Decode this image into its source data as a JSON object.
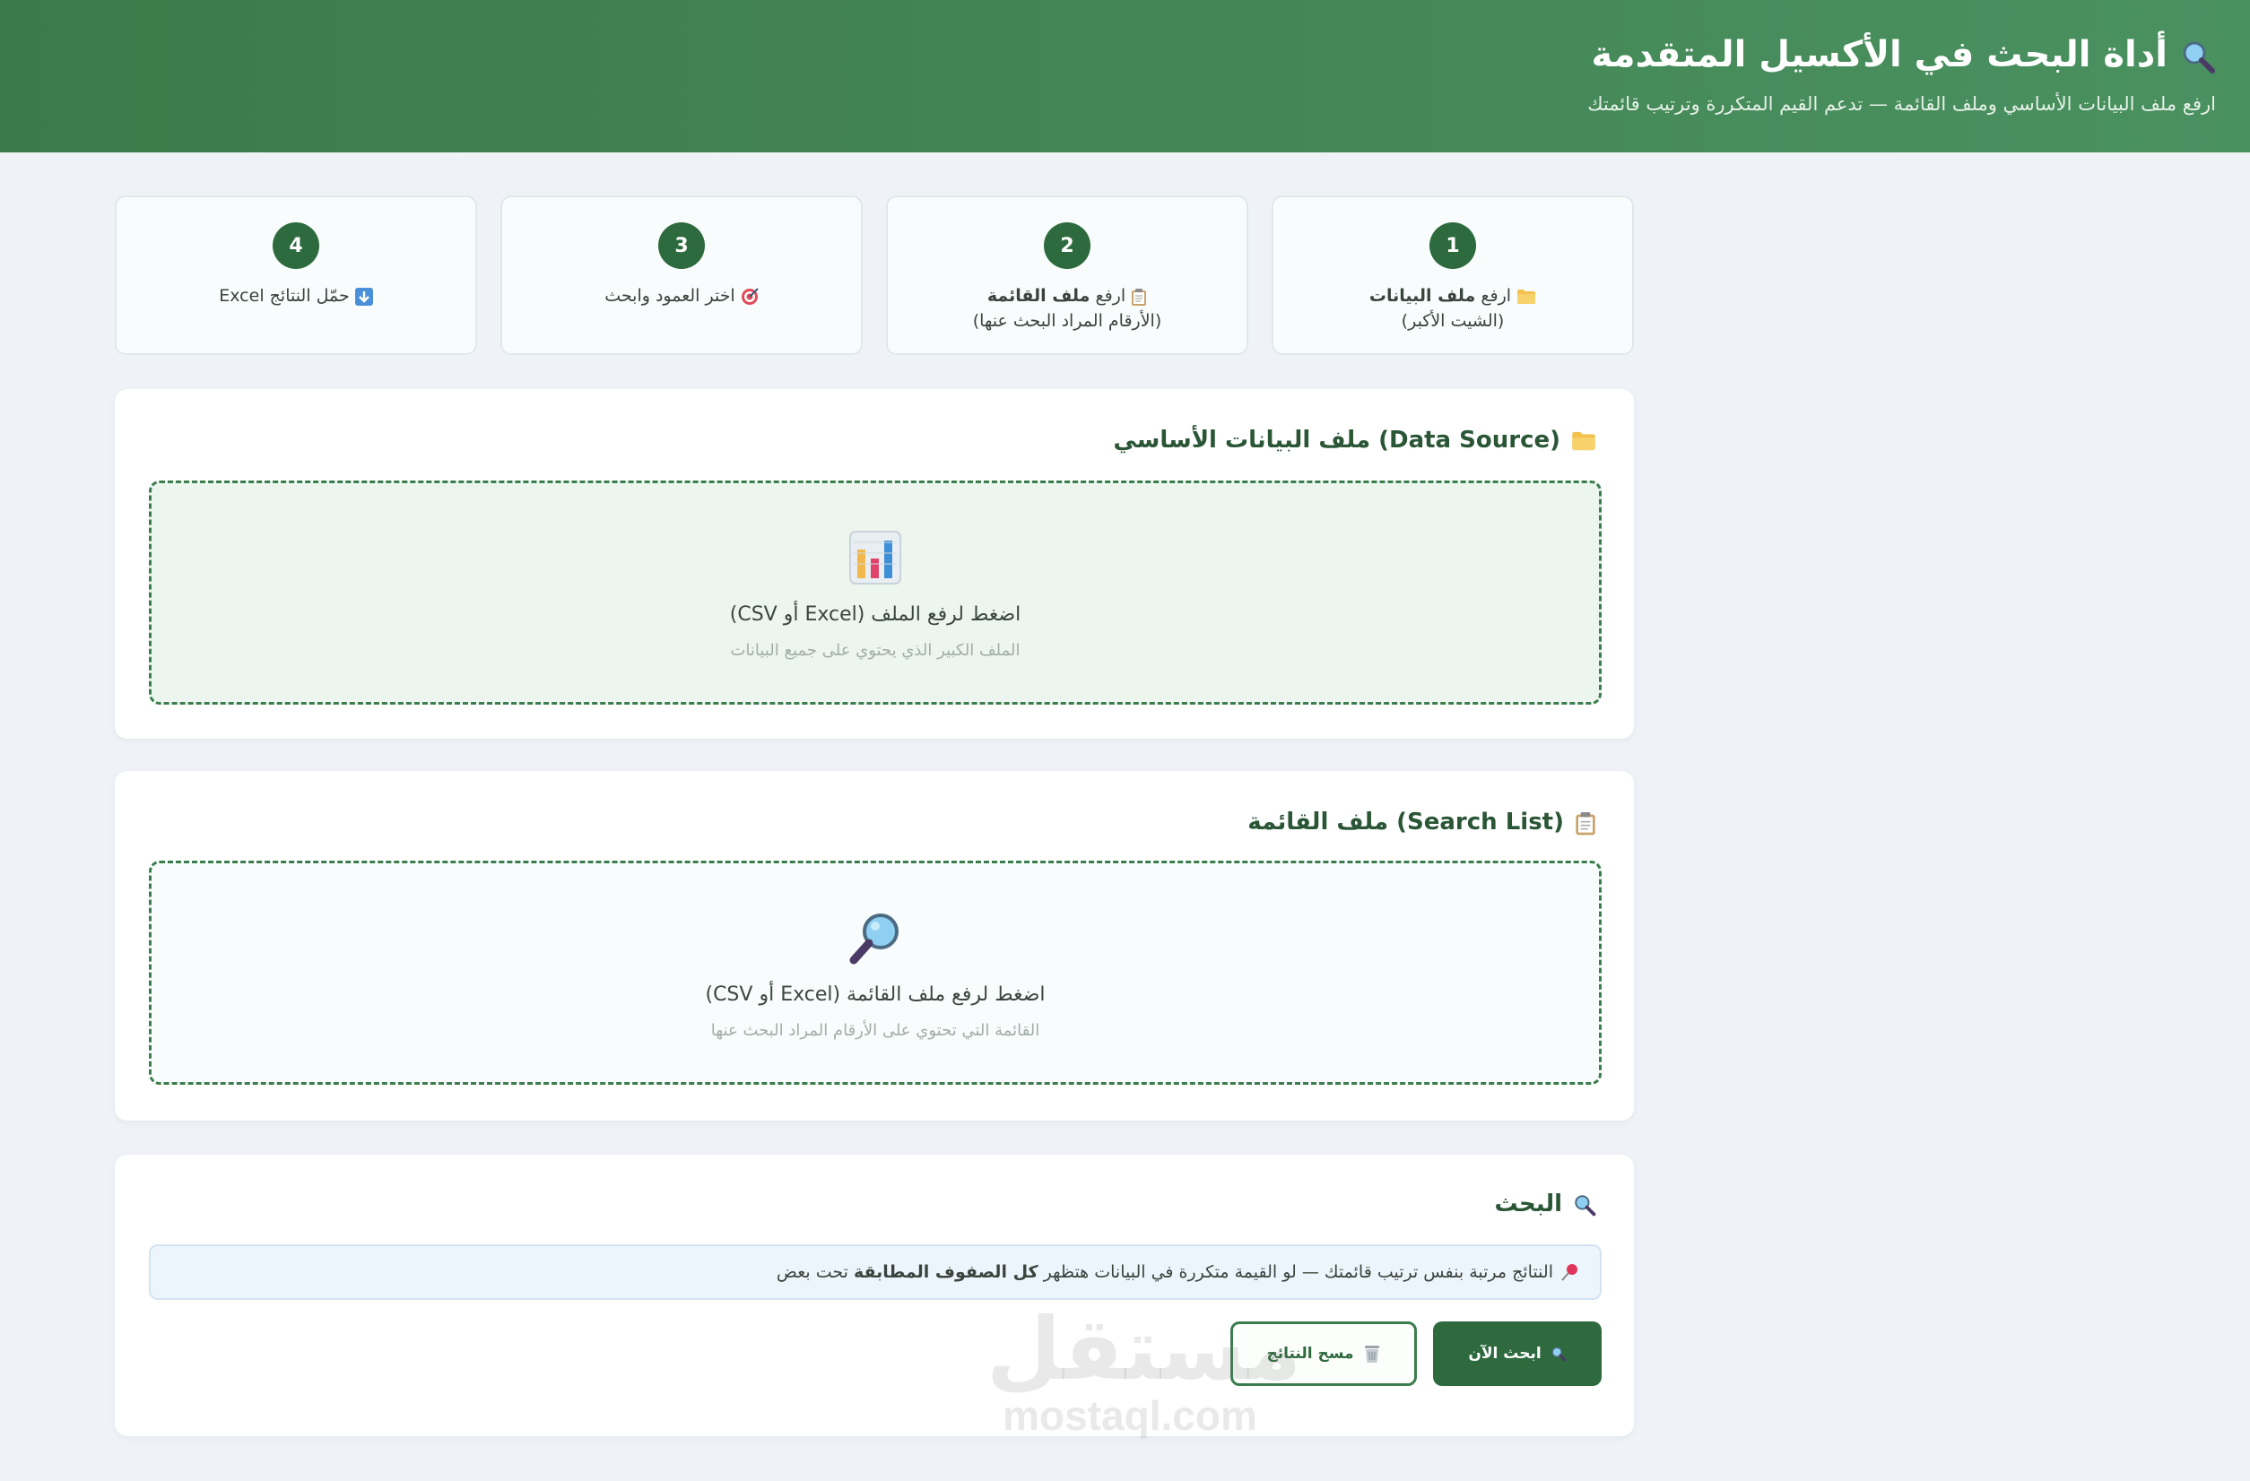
{
  "header": {
    "title": "أداة البحث في الأكسيل المتقدمة",
    "title_icon": "magnifier-icon",
    "subtitle": "ارفع ملف البيانات الأساسي وملف القائمة — تدعم القيم المتكررة وترتيب قائمتك"
  },
  "steps": [
    {
      "number": "1",
      "icon": "folder-icon",
      "prefix": "ارفع",
      "bold": "ملف البيانات",
      "line2": "(الشيت الأكبر)"
    },
    {
      "number": "2",
      "icon": "clipboard-icon",
      "prefix": "ارفع",
      "bold": "ملف القائمة",
      "line2": "(الأرقام المراد البحث عنها)"
    },
    {
      "number": "3",
      "icon": "target-icon",
      "prefix": "اختر العمود وابحث",
      "bold": "",
      "line2": ""
    },
    {
      "number": "4",
      "icon": "down-arrow-icon",
      "prefix": "حمّل النتائج Excel",
      "bold": "",
      "line2": ""
    }
  ],
  "data_source": {
    "title": "ملف البيانات الأساسي (Data Source)",
    "icon": "folder-icon",
    "drop_icon": "bar-chart-icon",
    "drop_main": "اضغط لرفع الملف (Excel أو CSV)",
    "drop_sub": "الملف الكبير الذي يحتوي على جميع البيانات"
  },
  "search_list": {
    "title": "ملف القائمة (Search List)",
    "icon": "clipboard-icon",
    "drop_icon": "magnifier-icon",
    "drop_main": "اضغط لرفع ملف القائمة (Excel أو CSV)",
    "drop_sub": "القائمة التي تحتوي على الأرقام المراد البحث عنها"
  },
  "search": {
    "title": "البحث",
    "icon": "magnifier-icon",
    "note_icon": "pushpin-icon",
    "note_text_1": "النتائج مرتبة بنفس ترتيب قائمتك — لو القيمة متكررة في البيانات هتظهر ",
    "note_bold": "كل الصفوف المطابقة",
    "note_text_2": " تحت بعض",
    "search_button": "ابحث الآن",
    "clear_button": "مسح النتائج"
  },
  "watermark": {
    "arabic": "مستقل",
    "latin": "mostaql.com"
  },
  "colors": {
    "brand_green": "#2e6a3e",
    "header_gradient_start": "#3d7a4b",
    "header_gradient_end": "#4a9160",
    "dropzone_border": "#3b7d4d",
    "dropzone_bg_active": "#ecf6ee",
    "dropzone_bg": "#f8fcfc",
    "note_bg": "#edf5fc",
    "page_bg": "#eff3f7"
  }
}
